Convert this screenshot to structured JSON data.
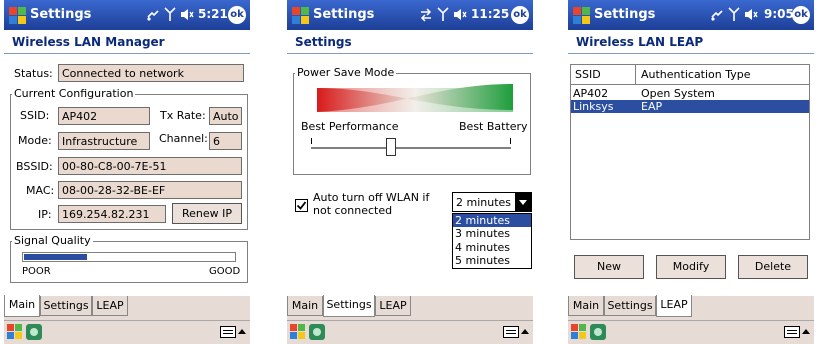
{
  "colors": {
    "titlebar": "#2a53b8",
    "field_bg": "#e9d9cf",
    "selection": "#2b4ea0",
    "signal_bar": "#2b4ea0",
    "gradient_red": "#d81b1b",
    "gradient_green": "#1e9e3c"
  },
  "screens": [
    {
      "titlebar": {
        "title": "Settings",
        "time": "5:21",
        "ok": "ok"
      },
      "page_title": "Wireless LAN Manager",
      "status": {
        "label": "Status:",
        "value": "Connected to network"
      },
      "config": {
        "legend": "Current Configuration",
        "ssid_label": "SSID:",
        "ssid_value": "AP402",
        "txrate_label": "Tx Rate:",
        "txrate_value": "Auto",
        "mode_label": "Mode:",
        "mode_value": "Infrastructure",
        "channel_label": "Channel:",
        "channel_value": "6",
        "bssid_label": "BSSID:",
        "bssid_value": "00-80-C8-00-7E-51",
        "mac_label": "MAC:",
        "mac_value": "08-00-28-32-BE-EF",
        "ip_label": "IP:",
        "ip_value": "169.254.82.231",
        "renew_button": "Renew IP"
      },
      "signal": {
        "legend": "Signal Quality",
        "poor": "POOR",
        "good": "GOOD",
        "level": 0.3
      },
      "tabs": [
        "Main",
        "Settings",
        "LEAP"
      ],
      "active_tab": 0
    },
    {
      "titlebar": {
        "title": "Settings",
        "time": "11:25",
        "ok": "ok"
      },
      "page_title": "Settings",
      "power": {
        "legend": "Power Save Mode",
        "left_label": "Best Performance",
        "right_label": "Best Battery",
        "slider_level": 0.4
      },
      "auto_off": {
        "label_line1": "Auto turn off WLAN if",
        "label_line2": "not connected",
        "checked": true
      },
      "dropdown": {
        "selected": "2 minutes",
        "options": [
          "2 minutes",
          "3 minutes",
          "4 minutes",
          "5 minutes"
        ],
        "highlighted": 0
      },
      "tabs": [
        "Main",
        "Settings",
        "LEAP"
      ],
      "active_tab": 1
    },
    {
      "titlebar": {
        "title": "Settings",
        "time": "9:05",
        "ok": "ok"
      },
      "page_title": "Wireless LAN LEAP",
      "table": {
        "headers": [
          "SSID",
          "Authentication Type"
        ],
        "rows": [
          {
            "ssid": "AP402",
            "auth": "Open System"
          },
          {
            "ssid": "Linksys",
            "auth": "EAP"
          }
        ],
        "selected_row": 1
      },
      "buttons": {
        "new": "New",
        "modify": "Modify",
        "delete": "Delete"
      },
      "tabs": [
        "Main",
        "Settings",
        "LEAP"
      ],
      "active_tab": 2
    }
  ]
}
